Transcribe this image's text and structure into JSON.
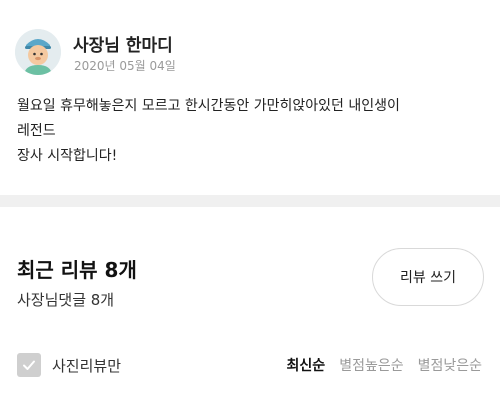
{
  "notice": {
    "owner_title": "사장님 한마디",
    "date": "2020년 05월 04일",
    "avatar_icon": "owner-character-avatar",
    "message_lines": [
      "월요일 휴무해놓은지 모르고 한시간동안 가만히앉아있던 내인생이",
      "레전드",
      "장사 시작합니다!"
    ]
  },
  "reviews": {
    "title": "최근 리뷰 8개",
    "owner_reply_count": "사장님댓글 8개",
    "write_button": "리뷰 쓰기",
    "photo_only_label": "사진리뷰만",
    "photo_only_checked": false,
    "sort_options": [
      "최신순",
      "별점높은순",
      "별점낮은순"
    ],
    "active_sort": "최신순"
  },
  "colors": {
    "background": "#f0f0f0",
    "card": "#ffffff",
    "muted_text": "#9a9a9a",
    "checkbox_gray": "#cfcfcf"
  }
}
